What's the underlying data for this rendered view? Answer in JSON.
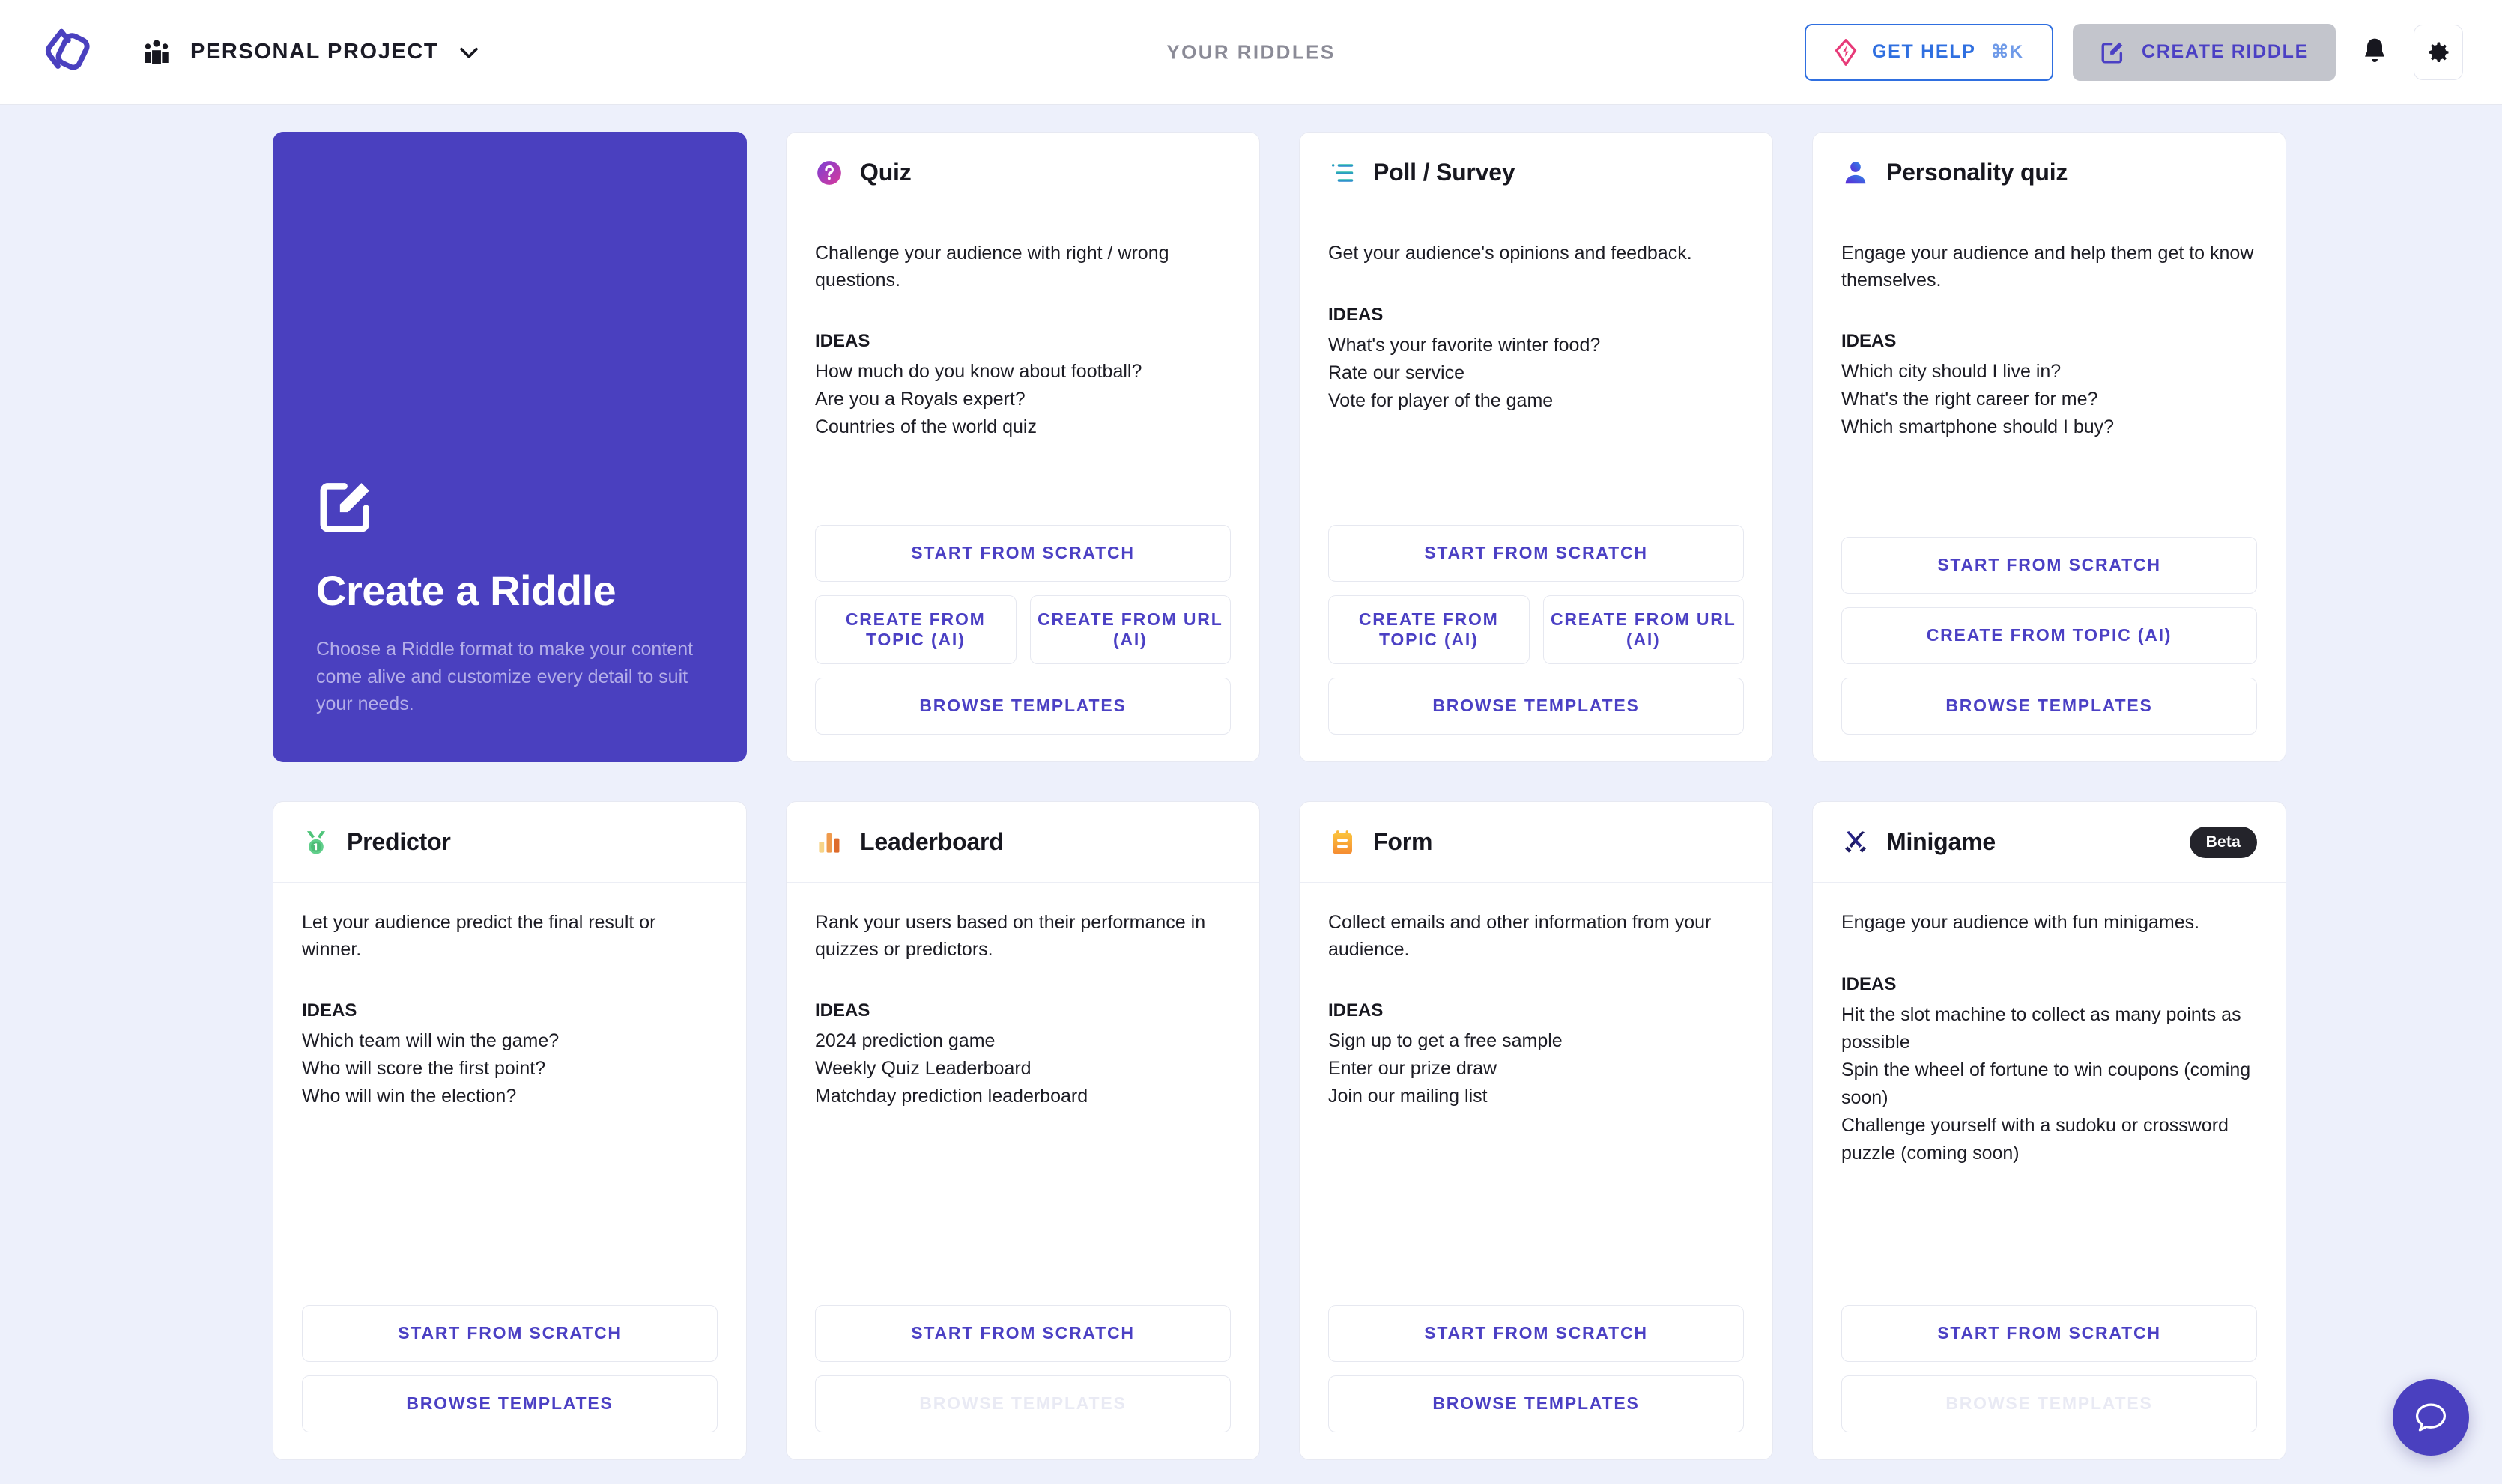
{
  "header": {
    "logo_icon": "riddle-logo-icon",
    "people_icon": "people-icon",
    "project_name": "PERSONAL PROJECT",
    "chevron_icon": "chevron-down-icon",
    "page_title": "YOUR RIDDLES",
    "get_help": {
      "label": "GET HELP",
      "shortcut": "⌘K",
      "icon": "bolt-icon"
    },
    "create_riddle": {
      "label": "CREATE RIDDLE",
      "icon": "pen-square-icon"
    },
    "bell_icon": "bell-icon",
    "gear_icon": "gear-icon"
  },
  "hero": {
    "icon": "pen-square-icon",
    "title": "Create a Riddle",
    "subtitle": "Choose a Riddle format to make your content come alive and customize every detail to suit your needs."
  },
  "ideas_label": "IDEAS",
  "cards": [
    {
      "id": "quiz",
      "icon": "question-circle-icon",
      "title": "Quiz",
      "description": "Challenge your audience with right / wrong questions.",
      "ideas": [
        "How much do you know about football?",
        "Are you a Royals expert?",
        "Countries of the world quiz"
      ],
      "buttons": {
        "scratch": "START FROM SCRATCH",
        "topic": "CREATE FROM TOPIC (AI)",
        "url": "CREATE FROM URL (AI)",
        "templates": "BROWSE TEMPLATES"
      }
    },
    {
      "id": "poll",
      "icon": "list-icon",
      "title": "Poll / Survey",
      "description": "Get your audience's opinions and feedback.",
      "ideas": [
        "What's your favorite winter food?",
        "Rate our service",
        "Vote for player of the game"
      ],
      "buttons": {
        "scratch": "START FROM SCRATCH",
        "topic": "CREATE FROM TOPIC (AI)",
        "url": "CREATE FROM URL (AI)",
        "templates": "BROWSE TEMPLATES"
      }
    },
    {
      "id": "personality",
      "icon": "person-icon",
      "title": "Personality quiz",
      "description": "Engage your audience and help them get to know themselves.",
      "ideas": [
        "Which city should I live in?",
        "What's the right career for me?",
        "Which smartphone should I buy?"
      ],
      "buttons": {
        "scratch": "START FROM SCRATCH",
        "topic": "CREATE FROM TOPIC (AI)",
        "templates": "BROWSE TEMPLATES"
      }
    },
    {
      "id": "predictor",
      "icon": "medal-icon",
      "title": "Predictor",
      "description": "Let your audience predict the final result or winner.",
      "ideas": [
        "Which team will win the game?",
        "Who will score the first point?",
        "Who will win the election?"
      ],
      "buttons": {
        "scratch": "START FROM SCRATCH",
        "templates": "BROWSE TEMPLATES"
      }
    },
    {
      "id": "leaderboard",
      "icon": "bar-chart-icon",
      "title": "Leaderboard",
      "description": "Rank your users based on their performance in quizzes or predictors.",
      "ideas": [
        "2024 prediction game",
        "Weekly Quiz Leaderboard",
        "Matchday prediction leaderboard"
      ],
      "buttons": {
        "scratch": "START FROM SCRATCH",
        "templates": "BROWSE TEMPLATES"
      }
    },
    {
      "id": "form",
      "icon": "clipboard-icon",
      "title": "Form",
      "description": "Collect emails and other information from your audience.",
      "ideas": [
        "Sign up to get a free sample",
        "Enter our prize draw",
        "Join our mailing list"
      ],
      "buttons": {
        "scratch": "START FROM SCRATCH",
        "templates": "BROWSE TEMPLATES"
      }
    },
    {
      "id": "minigame",
      "icon": "crossed-swords-icon",
      "title": "Minigame",
      "badge": "Beta",
      "description": "Engage your audience with fun minigames.",
      "ideas": [
        "Hit the slot machine to collect as many points as possible",
        "Spin the wheel of fortune to win coupons (coming soon)",
        "Challenge yourself with a sudoku or crossword puzzle (coming soon)"
      ],
      "buttons": {
        "scratch": "START FROM SCRATCH",
        "templates": "BROWSE TEMPLATES"
      }
    }
  ],
  "chat_widget": {
    "icon": "chat-bubble-icon"
  },
  "colors": {
    "brand_purple": "#4a40bf",
    "accent_blue": "#2f6fe0",
    "page_bg": "#edf0fb",
    "badge_dark": "#24242b"
  }
}
